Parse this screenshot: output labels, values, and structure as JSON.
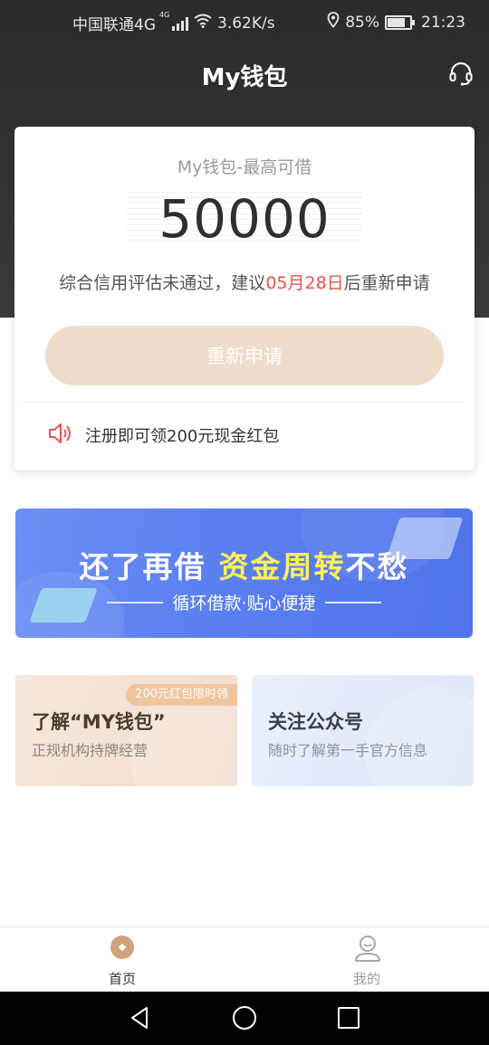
{
  "status_bar": {
    "carrier": "中国联通4G",
    "network_badge": "4G",
    "speed": "3.62K/s",
    "battery": "85%",
    "time": "21:23",
    "battery_level": 0.85,
    "icons": [
      "signal-icon",
      "wifi-icon",
      "location-icon",
      "battery-icon"
    ]
  },
  "header": {
    "title": "My钱包",
    "right_icon": "headset-icon"
  },
  "credit_card": {
    "subtitle": "My钱包-最高可借",
    "amount": "50000",
    "notice_prefix": "综合信用评估未通过，建议",
    "notice_date": "05月28日",
    "notice_suffix": "后重新申请",
    "button_label": "重新申请",
    "promo_text": "注册即可领200元现金红包",
    "promo_icon": "speaker-icon"
  },
  "banner": {
    "headline_part1": "还了再借",
    "headline_part2": "资金周转",
    "headline_part3": "不愁",
    "tagline": "循环借款·贴心便捷"
  },
  "tiles": [
    {
      "badge": "200元红包限时领",
      "title": "了解“MY钱包”",
      "subtitle": "正规机构持牌经营"
    },
    {
      "title": "关注公众号",
      "subtitle": "随时了解第一手官方信息"
    }
  ],
  "tab_bar": {
    "items": [
      {
        "label": "首页",
        "icon": "home-icon",
        "active": true
      },
      {
        "label": "我的",
        "icon": "user-icon",
        "active": false
      }
    ]
  },
  "system_nav": {
    "icons": [
      "back-icon",
      "home-circle-icon",
      "recents-icon"
    ]
  },
  "colors": {
    "accent_red": "#e8534f",
    "button_bg": "#efdccb",
    "header_bg": "#2b2b2d",
    "banner_blue": "#5a7ff0",
    "banner_highlight": "#fff25a"
  }
}
